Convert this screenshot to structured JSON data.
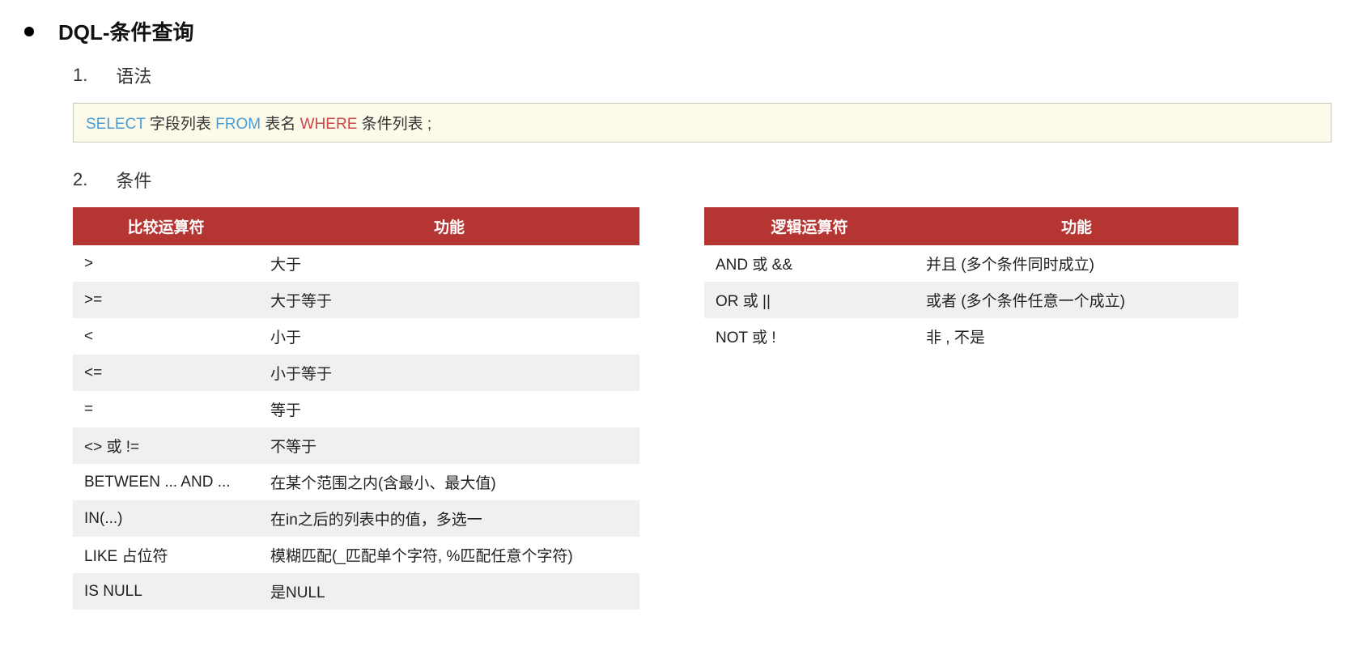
{
  "header": {
    "title": "DQL-条件查询"
  },
  "section1": {
    "num": "1.",
    "label": "语法",
    "syntax": {
      "select": "SELECT",
      "fields": " 字段列表 ",
      "from": "FROM",
      "table": "  表名  ",
      "where": "WHERE",
      "condition": "  条件列表 ;"
    }
  },
  "section2": {
    "num": "2.",
    "label": "条件"
  },
  "compare_table": {
    "header_op": "比较运算符",
    "header_func": "功能",
    "rows": [
      {
        "op": ">",
        "func": "大于"
      },
      {
        "op": ">=",
        "func": "大于等于"
      },
      {
        "op": "<",
        "func": "小于"
      },
      {
        "op": "<=",
        "func": "小于等于"
      },
      {
        "op": "=",
        "func": "等于"
      },
      {
        "op": "<>  或 !=",
        "func": "不等于"
      },
      {
        "op": "BETWEEN ... AND ...",
        "func": "在某个范围之内(含最小、最大值)"
      },
      {
        "op": "IN(...)",
        "func": "在in之后的列表中的值，多选一"
      },
      {
        "op": "LIKE  占位符",
        "func": "模糊匹配(_匹配单个字符, %匹配任意个字符)"
      },
      {
        "op": "IS NULL",
        "func": "是NULL"
      }
    ]
  },
  "logic_table": {
    "header_op": "逻辑运算符",
    "header_func": "功能",
    "rows": [
      {
        "op": "AND  或  &&",
        "func": "并且 (多个条件同时成立)"
      },
      {
        "op": "OR  或  ||",
        "func": "或者 (多个条件任意一个成立)"
      },
      {
        "op": "NOT  或  !",
        "func": "非 , 不是"
      }
    ]
  }
}
